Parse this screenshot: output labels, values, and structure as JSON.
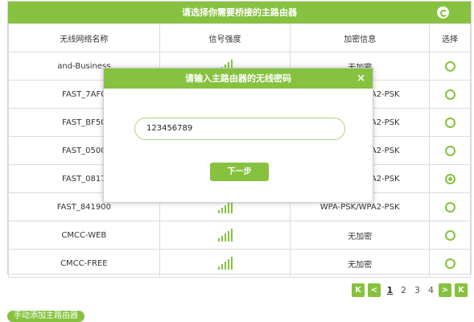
{
  "header": {
    "title": "请选择你需要桥接的主路由器",
    "refresh_icon": "refresh-icon"
  },
  "table": {
    "columns": [
      "无线网络名称",
      "信号强度",
      "加密信息",
      "选择"
    ],
    "rows": [
      {
        "ssid": "and-Business",
        "encryption": "无加密",
        "selected": false
      },
      {
        "ssid": "FAST_7AF0",
        "encryption": "WPA-PSK/WPA2-PSK",
        "selected": false
      },
      {
        "ssid": "FAST_BF50",
        "encryption": "WPA-PSK/WPA2-PSK",
        "selected": false
      },
      {
        "ssid": "FAST_0500",
        "encryption": "WPA-PSK/WPA2-PSK",
        "selected": false
      },
      {
        "ssid": "FAST_0817",
        "encryption": "WPA-PSK/WPA2-PSK",
        "selected": true
      },
      {
        "ssid": "FAST_841900",
        "encryption": "WPA-PSK/WPA2-PSK",
        "selected": false
      },
      {
        "ssid": "CMCC-WEB",
        "encryption": "无加密",
        "selected": false
      },
      {
        "ssid": "CMCC-FREE",
        "encryption": "无加密",
        "selected": false
      }
    ]
  },
  "pager": {
    "first": "K",
    "prev": "<",
    "pages": [
      "1",
      "2",
      "3",
      "4"
    ],
    "current": "1",
    "next": ">",
    "last": "K"
  },
  "manual_add": "手动添加主路由器",
  "modal": {
    "title": "请输入主路由器的无线密码",
    "close": "×",
    "password_value": "123456789",
    "next_button": "下一步"
  },
  "colors": {
    "accent": "#86c23f"
  }
}
